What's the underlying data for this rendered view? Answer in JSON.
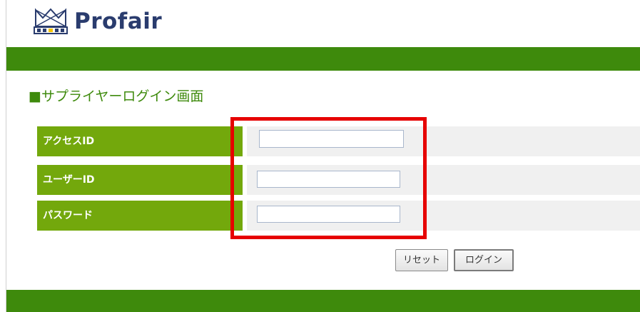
{
  "header": {
    "logo_text": "Profair",
    "logo_icon": "crown-icon"
  },
  "page": {
    "title": "■サプライヤーログイン画面"
  },
  "form": {
    "fields": [
      {
        "label": "アクセスID",
        "value": "",
        "placeholder": ""
      },
      {
        "label": "ユーザーID",
        "value": "",
        "placeholder": ""
      },
      {
        "label": "パスワード",
        "value": "",
        "placeholder": ""
      }
    ],
    "reset_label": "リセット",
    "login_label": "ログイン"
  },
  "colors": {
    "brand_green": "#3e8a0c",
    "label_green": "#73a80c",
    "logo_navy": "#2a3c6e",
    "highlight_red": "#e60000"
  }
}
